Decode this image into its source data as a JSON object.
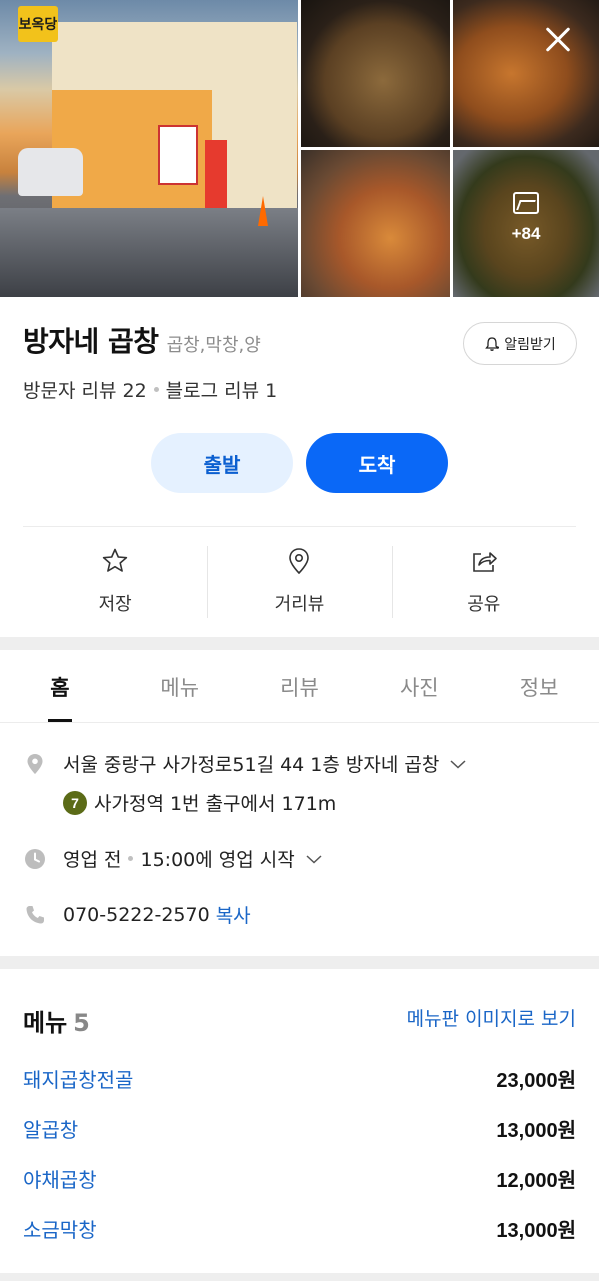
{
  "gallery": {
    "storefront_sign": "보옥당",
    "more_count": "+84"
  },
  "place": {
    "name": "방자네 곱창",
    "category": "곱창,막창,양",
    "notify_label": "알림받기",
    "visitor_reviews": "방문자 리뷰 22",
    "blog_reviews": "블로그 리뷰 1"
  },
  "route": {
    "depart_label": "출발",
    "arrive_label": "도착"
  },
  "actions": {
    "save": "저장",
    "street_view": "거리뷰",
    "share": "공유"
  },
  "tabs": [
    "홈",
    "메뉴",
    "리뷰",
    "사진",
    "정보"
  ],
  "info": {
    "address": "서울 중랑구 사가정로51길 44 1층 방자네 곱창",
    "subway_line": "7",
    "subway_directions": "사가정역 1번 출구에서 171m",
    "status": "영업 전",
    "hours": "15:00에 영업 시작",
    "phone": "070-5222-2570",
    "copy_label": "복사"
  },
  "menu": {
    "title": "메뉴",
    "count": "5",
    "board_link": "메뉴판 이미지로 보기",
    "items": [
      {
        "name": "돼지곱창전골",
        "price": "23,000원"
      },
      {
        "name": "알곱창",
        "price": "13,000원"
      },
      {
        "name": "야채곱창",
        "price": "12,000원"
      },
      {
        "name": "소금막창",
        "price": "13,000원"
      }
    ]
  },
  "colors": {
    "accent": "#0a68f7",
    "link": "#1a66c7",
    "subway_line7": "#5b6b17"
  }
}
